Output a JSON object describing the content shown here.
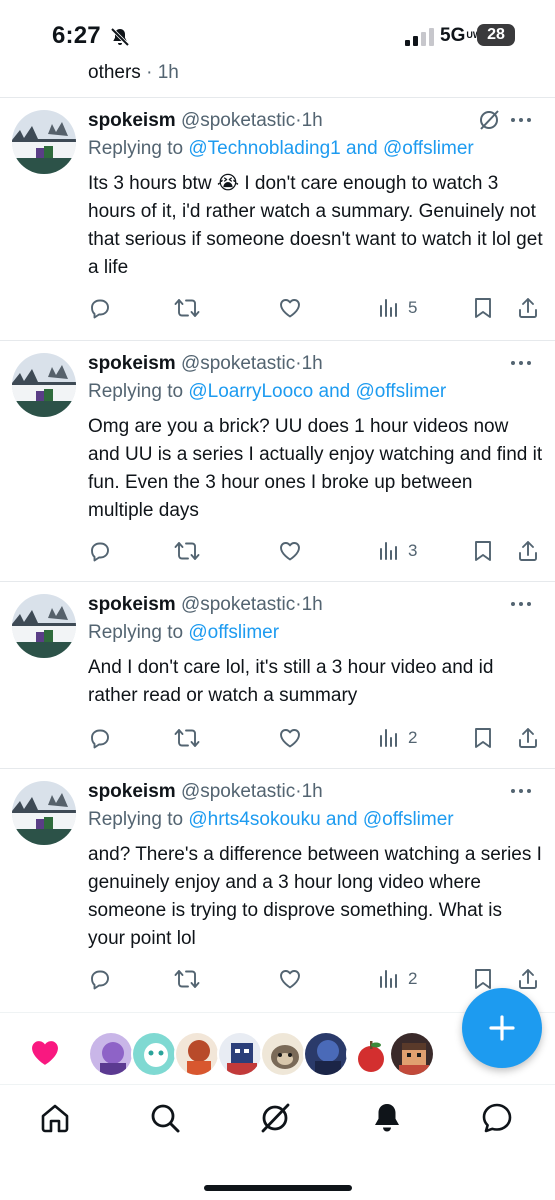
{
  "status_bar": {
    "time": "6:27",
    "network": "5G",
    "network_suffix": "UW",
    "battery": "28"
  },
  "previous_tweet_tail": {
    "text": "others",
    "time": "· 1h"
  },
  "tweets": [
    {
      "display_name": "spokeism",
      "handle": "@spoketastic",
      "time": "1h",
      "replying_prefix": "Replying to",
      "replying_users": "@Technoblading1 and @offslimer",
      "text": "Its 3 hours btw 😭 I don't care enough to watch 3 hours of it, i'd rather watch a summary. Genuinely not that serious if someone doesn't want to watch it lol get a life",
      "views": "5"
    },
    {
      "display_name": "spokeism",
      "handle": "@spoketastic",
      "time": "1h",
      "replying_prefix": "Replying to",
      "replying_users": "@LoarryLooco and @offslimer",
      "text": "Omg are you a brick? UU does 1 hour videos now and UU is a series I actually enjoy watching and find it fun. Even the 3 hour ones I broke up between multiple days",
      "views": "3"
    },
    {
      "display_name": "spokeism",
      "handle": "@spoketastic",
      "time": "1h",
      "replying_prefix": "Replying to",
      "replying_users": "@offslimer",
      "text": "And I don't care lol, it's still a 3 hour video and id rather read or watch a summary",
      "views": "2"
    },
    {
      "display_name": "spokeism",
      "handle": "@spoketastic",
      "time": "1h",
      "replying_prefix": "Replying to",
      "replying_users": "@hrts4sokouku and @offslimer",
      "text": "and? There's a difference between watching a series I genuinely enjoy and a 3 hour long video where someone is trying to disprove something. What is your point lol",
      "views": "2"
    }
  ],
  "colors": {
    "accent": "#1d9bf0",
    "text": "#0f1419",
    "muted": "#536471",
    "heart": "#f91880"
  },
  "icons": {
    "reply": "reply-icon",
    "retweet": "retweet-icon",
    "like": "heart-icon",
    "views": "views-icon",
    "bookmark": "bookmark-icon",
    "share": "share-icon",
    "more": "more-icon",
    "grok": "grok-icon",
    "compose": "plus-icon",
    "nav": [
      "home-icon",
      "search-icon",
      "grok-icon",
      "notifications-icon",
      "messages-icon"
    ]
  }
}
